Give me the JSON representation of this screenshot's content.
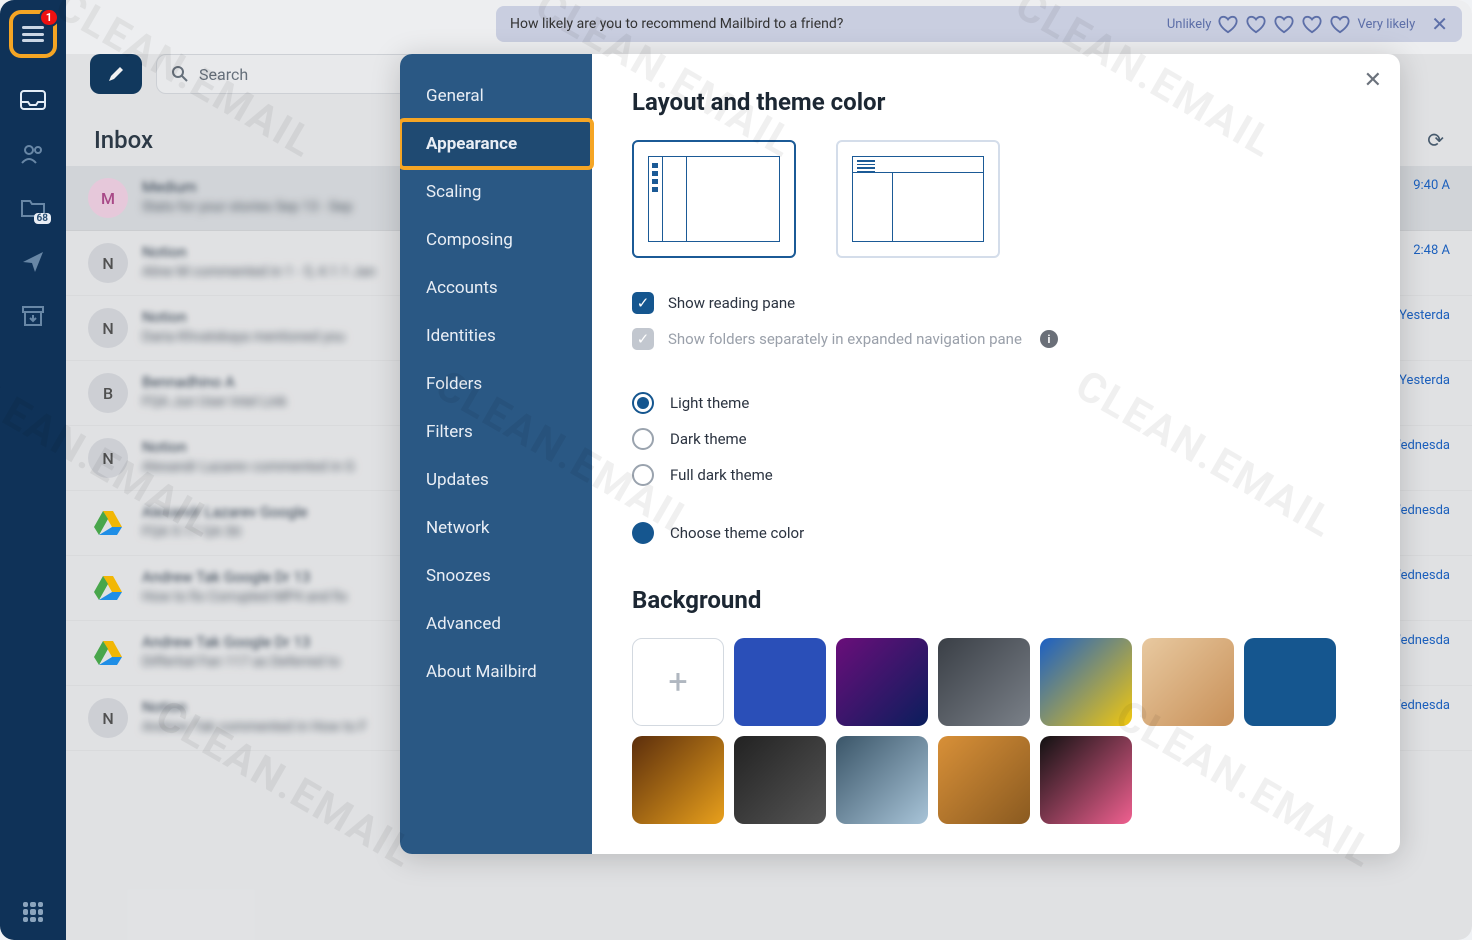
{
  "leftbar": {
    "badge": "1",
    "folder_count": "68"
  },
  "survey": {
    "question": "How likely are you to recommend Mailbird to a friend?",
    "unlikely": "Unlikely",
    "likely": "Very likely"
  },
  "toolbar": {
    "search_placeholder": "Search"
  },
  "inbox": {
    "title": "Inbox",
    "messages": [
      {
        "avatar": "M",
        "avatar_class": "m",
        "sender": "Medium",
        "preview": "Stats for your stories Sep 13 - Sep",
        "time": "9:40 A"
      },
      {
        "avatar": "N",
        "avatar_class": "",
        "sender": "Notion",
        "preview": "Aline M commented in 1 - 5, 4.1.1 Jan",
        "time": "2:48 A"
      },
      {
        "avatar": "N",
        "avatar_class": "",
        "sender": "Notion",
        "preview": "Daria Khvatskaya mentioned you",
        "time": "Yesterda"
      },
      {
        "avatar": "B",
        "avatar_class": "",
        "sender": "Bennadhino A",
        "preview": "FQA Jun User Intel Link",
        "time": "Yesterda"
      },
      {
        "avatar": "N",
        "avatar_class": "",
        "sender": "Notion",
        "preview": "Alexandr Lazarev commented in G",
        "time": "Wednesda"
      },
      {
        "avatar": "gd",
        "avatar_class": "gdrive",
        "sender": "Alexandr Lazarev Google",
        "preview": "FQA 9.17 QA Sti",
        "time": "Wednesda"
      },
      {
        "avatar": "gd",
        "avatar_class": "gdrive",
        "sender": "Andrew Tak Google Dr 13",
        "preview": "How to fix Corrupted MP4 and fix",
        "time": "Wednesda"
      },
      {
        "avatar": "gd",
        "avatar_class": "gdrive",
        "sender": "Andrew Tak Google Dr 13",
        "preview": "Differtial Fan 117 as Deferred to",
        "time": "Wednesda"
      },
      {
        "avatar": "N",
        "avatar_class": "",
        "sender": "Notion",
        "preview": "Andrew Tak commented in How to F",
        "time": "Wednesda"
      }
    ]
  },
  "settings": {
    "nav": [
      "General",
      "Appearance",
      "Scaling",
      "Composing",
      "Accounts",
      "Identities",
      "Folders",
      "Filters",
      "Updates",
      "Network",
      "Snoozes",
      "Advanced",
      "About Mailbird"
    ],
    "active_nav": "Appearance",
    "layout_title": "Layout and theme color",
    "show_reading_pane": "Show reading pane",
    "show_folders_sep": "Show folders separately in expanded navigation pane",
    "themes": {
      "light": "Light theme",
      "dark": "Dark theme",
      "full_dark": "Full dark theme",
      "choose": "Choose theme color"
    },
    "background_title": "Background",
    "bg_tiles": [
      "add",
      "#2a4fb8",
      "linear-gradient(135deg,#6a0e7a,#0a1e5c)",
      "linear-gradient(135deg,#3a3f46,#7a8088)",
      "linear-gradient(135deg,#1b5fc4,#f2c80f)",
      "linear-gradient(135deg,#e8c9a0,#c89058)",
      "#15568f",
      "linear-gradient(135deg,#5c2e0c,#e8a01c)",
      "linear-gradient(135deg,#222,#555)",
      "linear-gradient(135deg,#3a5568,#a8c4d8)",
      "linear-gradient(135deg,#d89038,#8a5a20)",
      "linear-gradient(135deg,#111,#f06090)"
    ]
  }
}
